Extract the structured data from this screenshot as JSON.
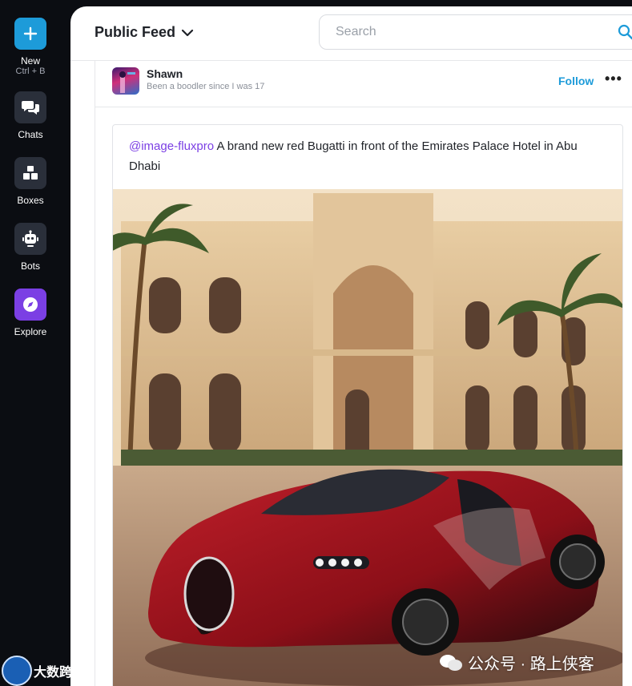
{
  "sidebar": {
    "items": [
      {
        "label": "New",
        "sub": "Ctrl + B",
        "icon": "plus-icon"
      },
      {
        "label": "Chats",
        "icon": "chat-bubbles-icon"
      },
      {
        "label": "Boxes",
        "icon": "boxes-icon"
      },
      {
        "label": "Bots",
        "icon": "robot-icon"
      },
      {
        "label": "Explore",
        "icon": "compass-icon"
      }
    ]
  },
  "header": {
    "title": "Public Feed",
    "search_placeholder": "Search"
  },
  "post": {
    "user_name": "Shawn",
    "user_bio": "Been a boodler since I was 17",
    "follow_label": "Follow",
    "more_label": "•••",
    "mention": "@image-fluxpro",
    "prompt_text": " A brand new red Bugatti in front of the Emirates Palace Hotel in Abu Dhabi"
  },
  "watermarks": {
    "right": "公众号 · 路上侠客",
    "left": "大数跨境"
  },
  "colors": {
    "accent_blue": "#1d9bd9",
    "accent_purple": "#7b3fe4",
    "sidebar_bg": "#0b0d12"
  }
}
